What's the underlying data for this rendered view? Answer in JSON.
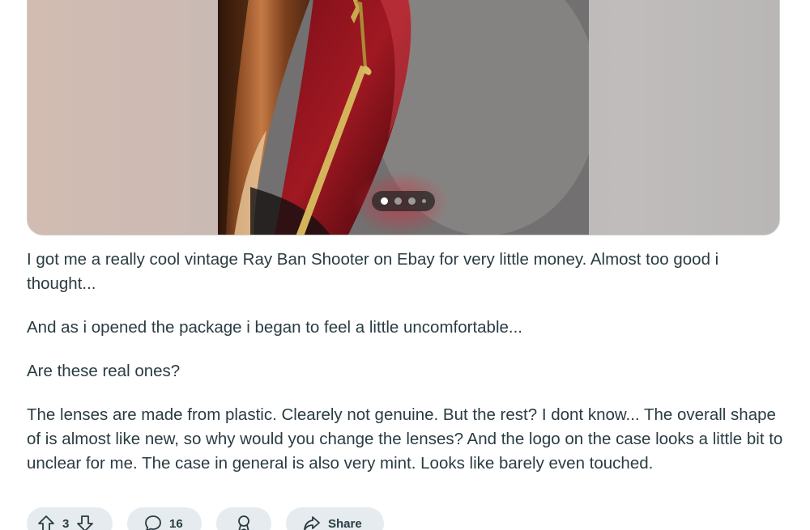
{
  "gallery": {
    "image_alt": "Close-up of vintage Ray Ban Shooter sunglasses with red-tinted lens and gold frame wire",
    "page_count": 4,
    "active_index": 0
  },
  "post": {
    "paragraphs": [
      "I got me a really cool vintage Ray Ban Shooter on Ebay for very little money. Almost too good i thought...",
      "And as i opened the package i began to feel a little uncomfortable...",
      "Are these real ones?",
      "The lenses are made from plastic. Clearely not genuine. But the rest? I dont know... The overall shape of is almost like new, so why would you change the lenses? And the logo on the case looks a little bit to unclear for me. The case in general is also very mint. Looks like barely even touched."
    ]
  },
  "actions": {
    "upvote_icon": "upvote-arrow-icon",
    "vote_count": "3",
    "downvote_icon": "downvote-arrow-icon",
    "comment_icon": "speech-bubble-icon",
    "comment_count": "16",
    "award_icon": "award-icon",
    "share_icon": "share-arrow-icon",
    "share_label": "Share"
  },
  "colors": {
    "text": "#2a3c42",
    "pill_bg": "#e5ebee",
    "dot_active": "#ffffff"
  }
}
